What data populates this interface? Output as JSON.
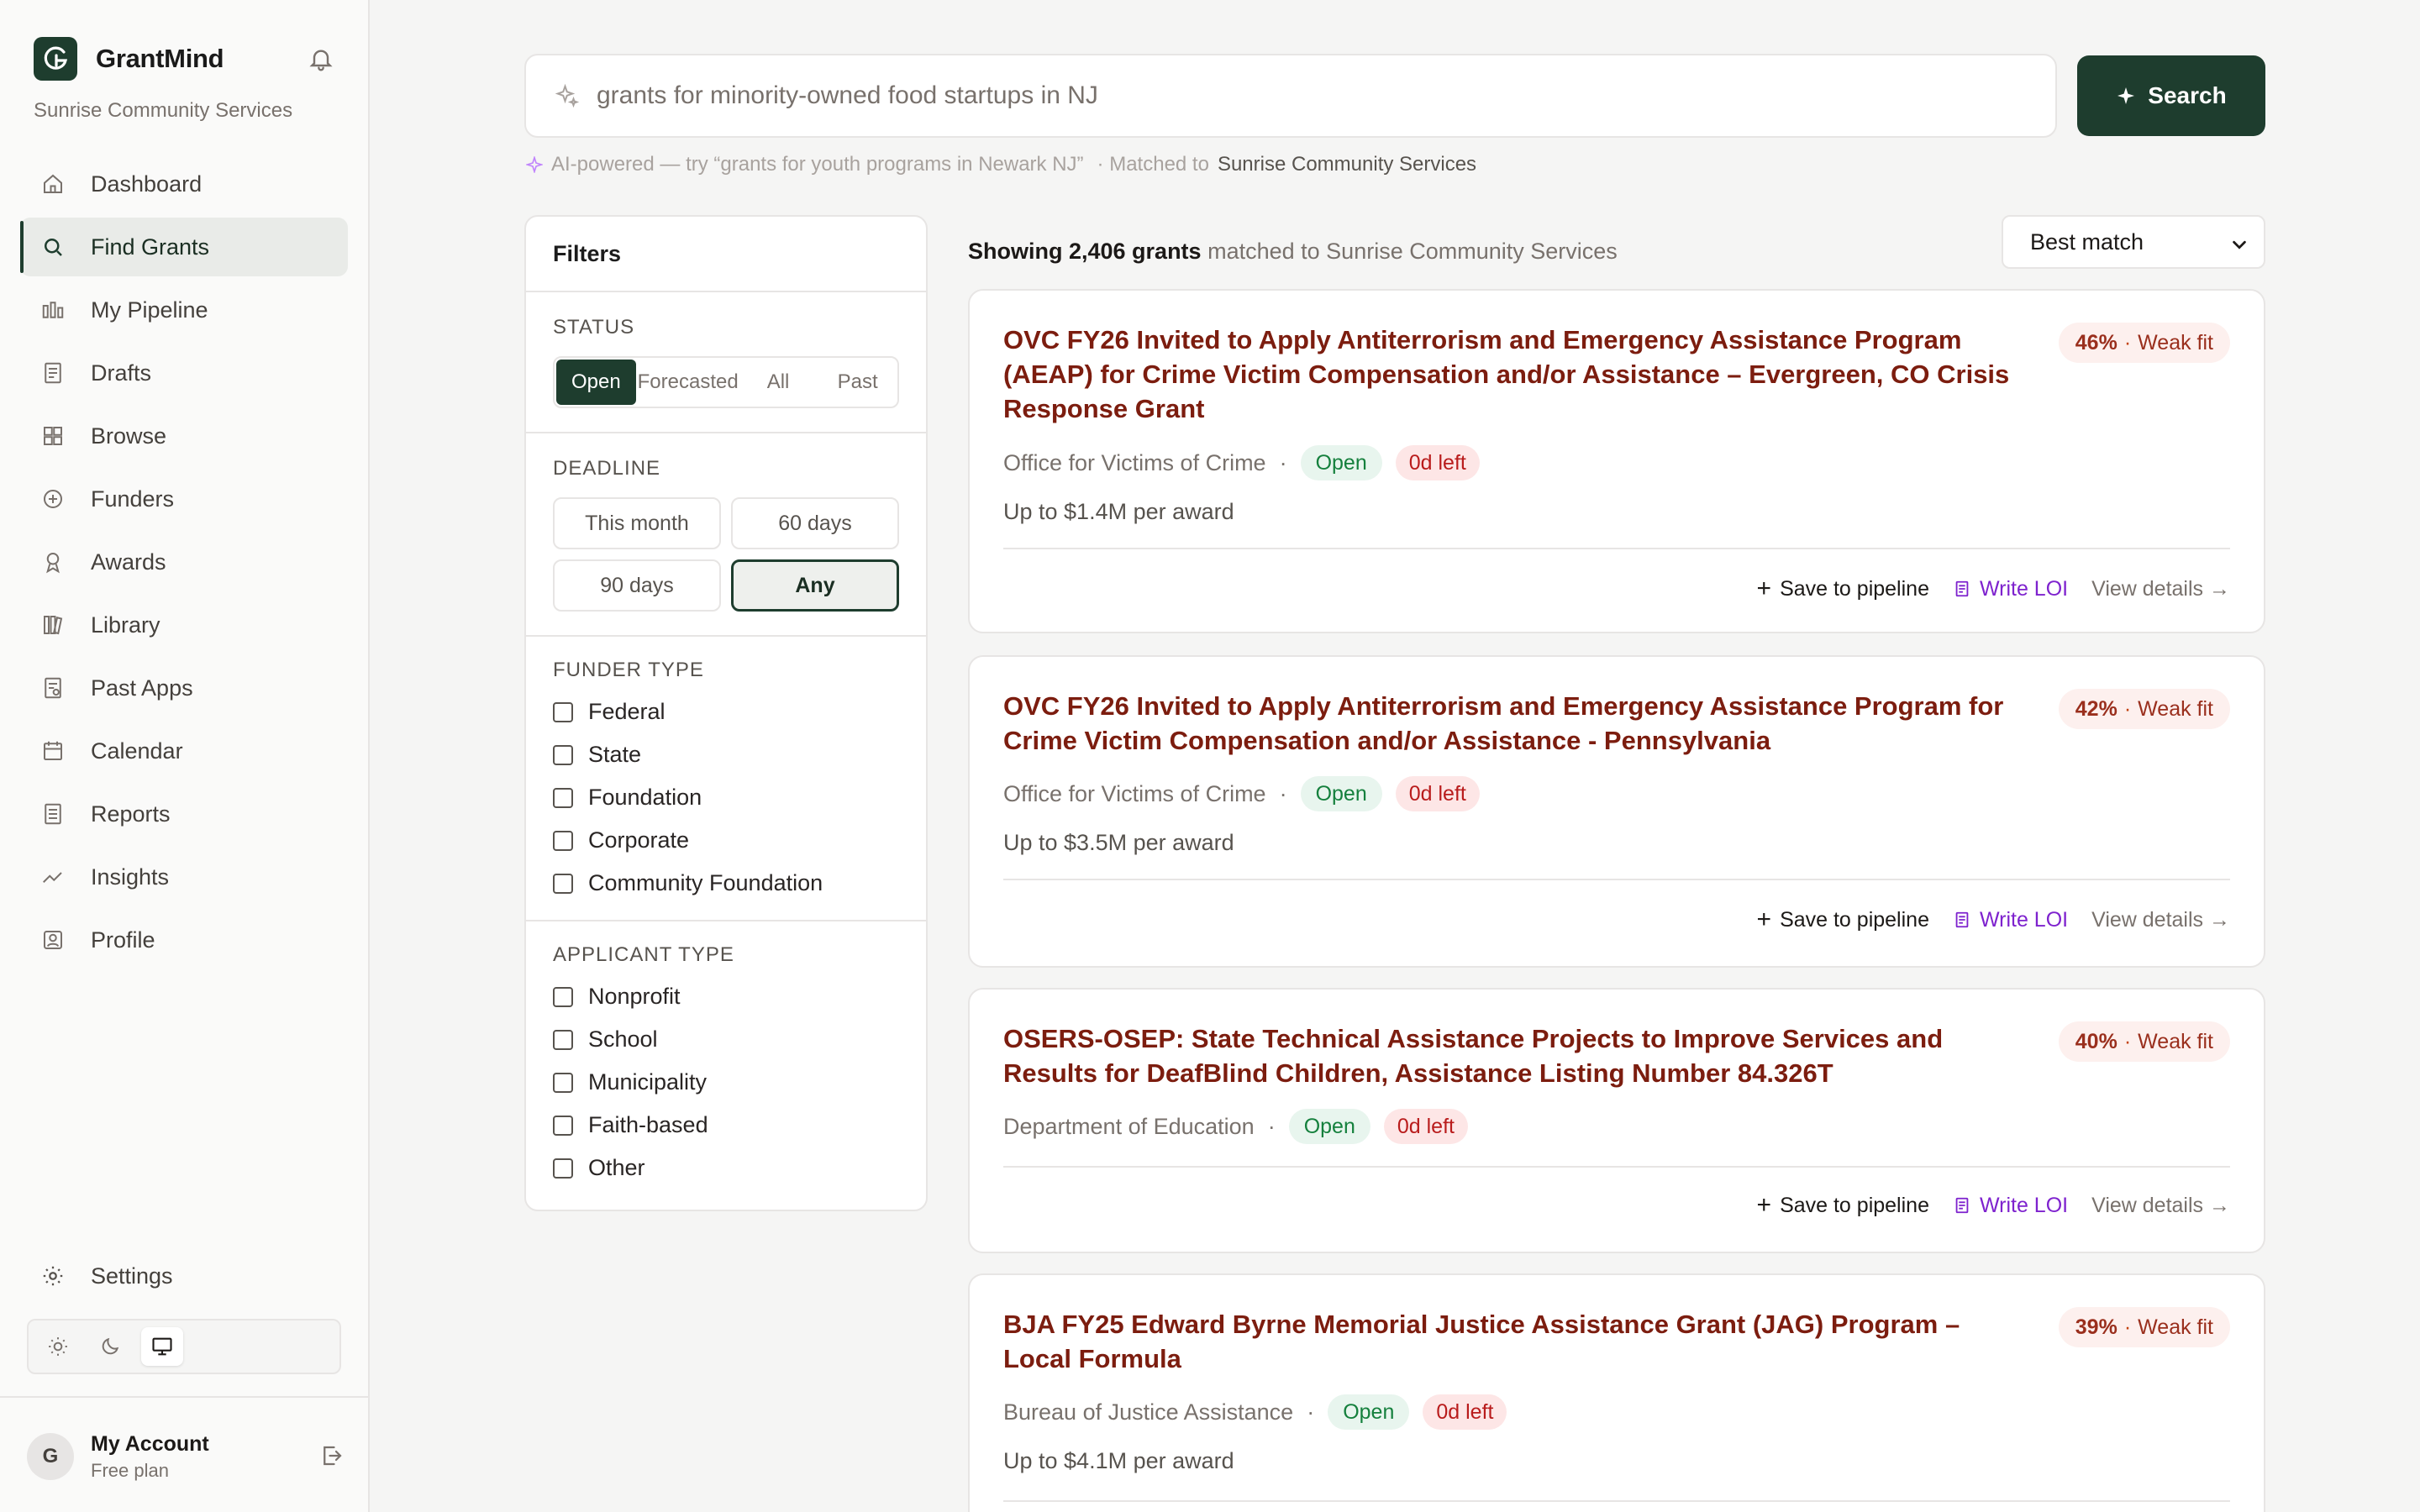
{
  "app": {
    "name": "GrantMind",
    "org": "Sunrise Community Services"
  },
  "nav": [
    {
      "label": "Dashboard",
      "icon": "home-icon"
    },
    {
      "label": "Find Grants",
      "icon": "search-icon",
      "active": true
    },
    {
      "label": "My Pipeline",
      "icon": "pipeline-icon"
    },
    {
      "label": "Drafts",
      "icon": "document-icon"
    },
    {
      "label": "Browse",
      "icon": "grid-icon"
    },
    {
      "label": "Funders",
      "icon": "circle-plus-icon"
    },
    {
      "label": "Awards",
      "icon": "award-icon"
    },
    {
      "label": "Library",
      "icon": "library-icon"
    },
    {
      "label": "Past Apps",
      "icon": "past-apps-icon"
    },
    {
      "label": "Calendar",
      "icon": "calendar-icon"
    },
    {
      "label": "Reports",
      "icon": "report-icon"
    },
    {
      "label": "Insights",
      "icon": "trend-icon"
    },
    {
      "label": "Profile",
      "icon": "profile-icon"
    }
  ],
  "settings_label": "Settings",
  "account": {
    "initial": "G",
    "name": "My Account",
    "plan": "Free plan"
  },
  "search": {
    "value": "grants for minority-owned food startups in NJ",
    "button": "Search",
    "hint_prefix": "AI-powered — try “grants for youth programs in Newark NJ”",
    "hint_matched": "· Matched to",
    "hint_org": "Sunrise Community Services"
  },
  "filters": {
    "title": "Filters",
    "status": {
      "label": "STATUS",
      "options": [
        "Open",
        "Forecasted",
        "All",
        "Past"
      ],
      "selected": "Open"
    },
    "deadline": {
      "label": "DEADLINE",
      "options": [
        "This month",
        "60 days",
        "90 days",
        "Any"
      ],
      "selected": "Any"
    },
    "funder_type": {
      "label": "FUNDER TYPE",
      "options": [
        "Federal",
        "State",
        "Foundation",
        "Corporate",
        "Community Foundation"
      ]
    },
    "applicant_type": {
      "label": "APPLICANT TYPE",
      "options": [
        "Nonprofit",
        "School",
        "Municipality",
        "Faith-based",
        "Other"
      ]
    }
  },
  "results": {
    "showing_prefix": "Showing 2,406 grants",
    "showing_suffix": "matched to Sunrise Community Services",
    "sort": "Best match"
  },
  "actions": {
    "save": "Save to pipeline",
    "loi": "Write LOI",
    "view": "View details →"
  },
  "grants": [
    {
      "title": "OVC FY26 Invited to Apply Antiterrorism and Emergency Assistance Program (AEAP) for Crime Victim Compensation and/or Assistance – Evergreen, CO Crisis Response Grant",
      "fit_pct": "46%",
      "fit_label": "Weak fit",
      "funder": "Office for Victims of Crime",
      "status": "Open",
      "days_left": "0d left",
      "amount": "Up to $1.4M per award"
    },
    {
      "title": "OVC FY26 Invited to Apply Antiterrorism and Emergency Assistance Program for Crime Victim Compensation and/or Assistance - Pennsylvania",
      "fit_pct": "42%",
      "fit_label": "Weak fit",
      "funder": "Office for Victims of Crime",
      "status": "Open",
      "days_left": "0d left",
      "amount": "Up to $3.5M per award"
    },
    {
      "title": "OSERS-OSEP: State Technical Assistance Projects to Improve Services and Results for DeafBlind Children, Assistance Listing Number 84.326T",
      "fit_pct": "40%",
      "fit_label": "Weak fit",
      "funder": "Department of Education",
      "status": "Open",
      "days_left": "0d left",
      "amount": ""
    },
    {
      "title": "BJA FY25 Edward Byrne Memorial Justice Assistance Grant (JAG) Program – Local Formula",
      "fit_pct": "39%",
      "fit_label": "Weak fit",
      "funder": "Bureau of Justice Assistance",
      "status": "Open",
      "days_left": "0d left",
      "amount": "Up to $4.1M per award"
    }
  ],
  "colors": {
    "brand": "#1e3d2e",
    "title": "#7c1d0f",
    "loi": "#7e22ce",
    "open": "#15803d",
    "danger": "#b91c1c"
  }
}
